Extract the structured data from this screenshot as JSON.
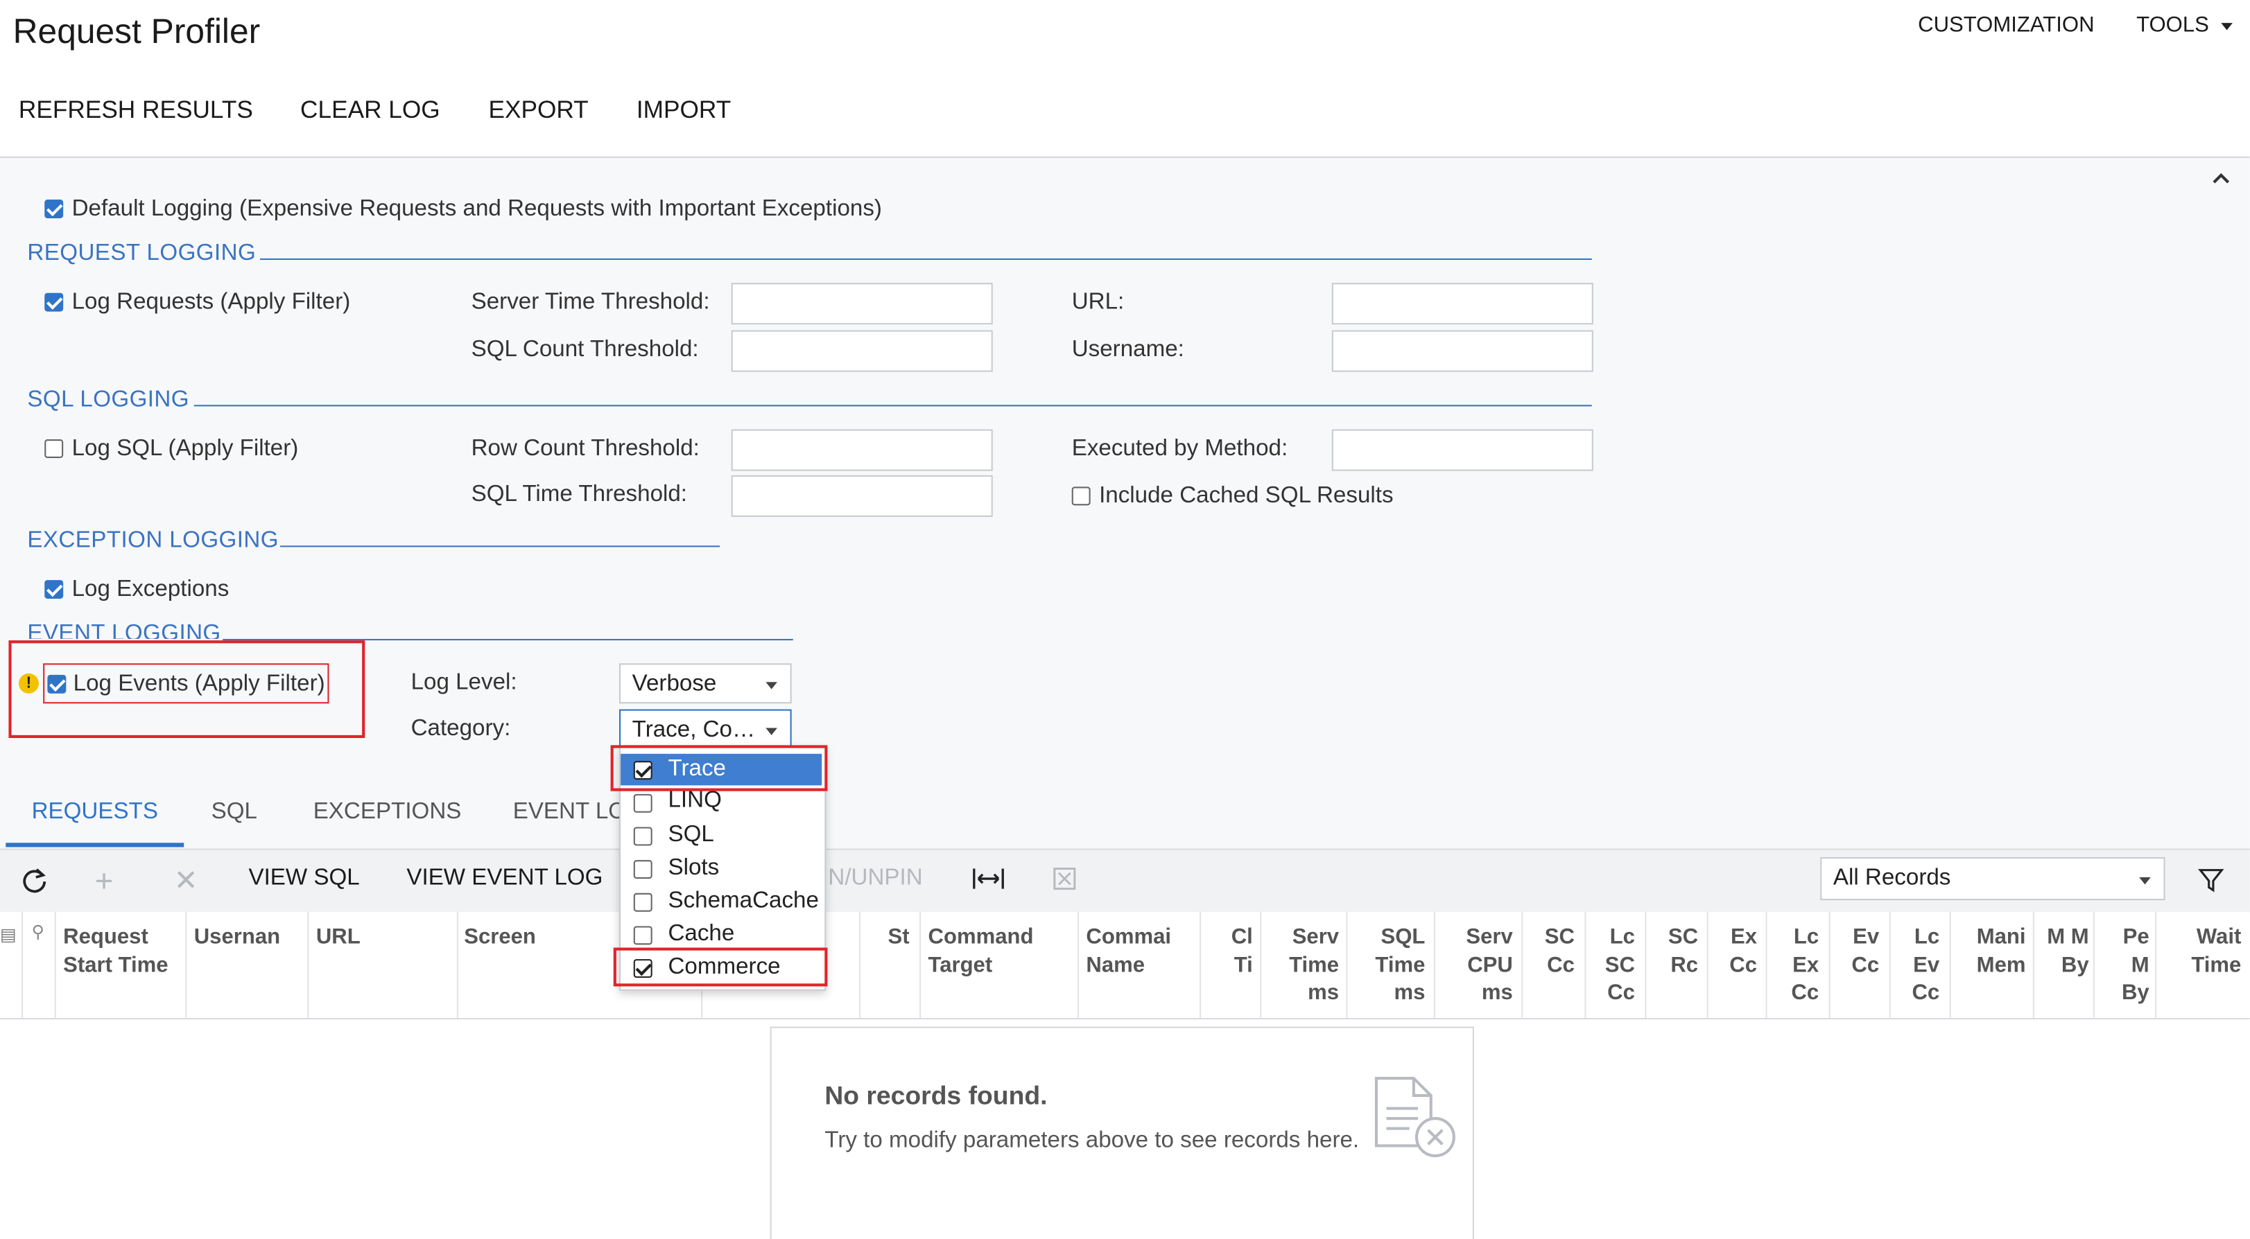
{
  "header": {
    "title": "Request Profiler",
    "nav": {
      "customization": "CUSTOMIZATION",
      "tools": "TOOLS"
    },
    "actions": [
      "REFRESH RESULTS",
      "CLEAR LOG",
      "EXPORT",
      "IMPORT"
    ]
  },
  "form": {
    "default_logging": "Default Logging (Expensive Requests and Requests with Important Exceptions)",
    "request_logging": {
      "section": "REQUEST LOGGING",
      "log_requests": "Log Requests (Apply Filter)",
      "server_time_threshold": "Server Time Threshold:",
      "sql_count_threshold": "SQL Count Threshold:",
      "url": "URL:",
      "username": "Username:"
    },
    "sql_logging": {
      "section": "SQL LOGGING",
      "log_sql": "Log SQL (Apply Filter)",
      "row_count_threshold": "Row Count Threshold:",
      "sql_time_threshold": "SQL Time Threshold:",
      "executed_by_method": "Executed by Method:",
      "include_cached": "Include Cached SQL Results"
    },
    "exception_logging": {
      "section": "EXCEPTION LOGGING",
      "log_exceptions": "Log Exceptions"
    },
    "event_logging": {
      "section": "EVENT LOGGING",
      "log_events": "Log Events (Apply Filter)",
      "log_level_label": "Log Level:",
      "log_level_value": "Verbose",
      "category_label": "Category:",
      "category_value": "Trace, Co…"
    }
  },
  "category_options": [
    {
      "label": "Trace",
      "checked": true,
      "highlighted": true
    },
    {
      "label": "LINQ",
      "checked": false
    },
    {
      "label": "SQL",
      "checked": false
    },
    {
      "label": "Slots",
      "checked": false
    },
    {
      "label": "SchemaCache",
      "checked": false
    },
    {
      "label": "Cache",
      "checked": false
    },
    {
      "label": "Commerce",
      "checked": true
    }
  ],
  "tabs": [
    "REQUESTS",
    "SQL",
    "EXCEPTIONS",
    "EVENT LO"
  ],
  "grid_toolbar": {
    "view_sql": "VIEW SQL",
    "view_event_log": "VIEW EVENT LOG",
    "pin_unpin": "IN/UNPIN",
    "filter_value": "All Records"
  },
  "columns": [
    "Request Start Time",
    "Usernan",
    "URL",
    "Screen",
    "St",
    "Command Target",
    "Commai Name",
    "Cl Ti",
    "Serv Time ms",
    "SQL Time ms",
    "Serv CPU ms",
    "SC Cc",
    "Lc SC Cc",
    "SC Rc",
    "Ex Cc",
    "Lc Ex Cc",
    "Ev Cc",
    "Lc Ev Cc",
    "Mani Mem",
    "M M By",
    "Pe M By",
    "Wait Time"
  ],
  "empty_state": {
    "title": "No records found.",
    "subtitle": "Try to modify parameters above to see records here."
  },
  "colors": {
    "accent": "#2f74c9",
    "highlight_box": "#e0242b",
    "warning": "#f2c200"
  }
}
